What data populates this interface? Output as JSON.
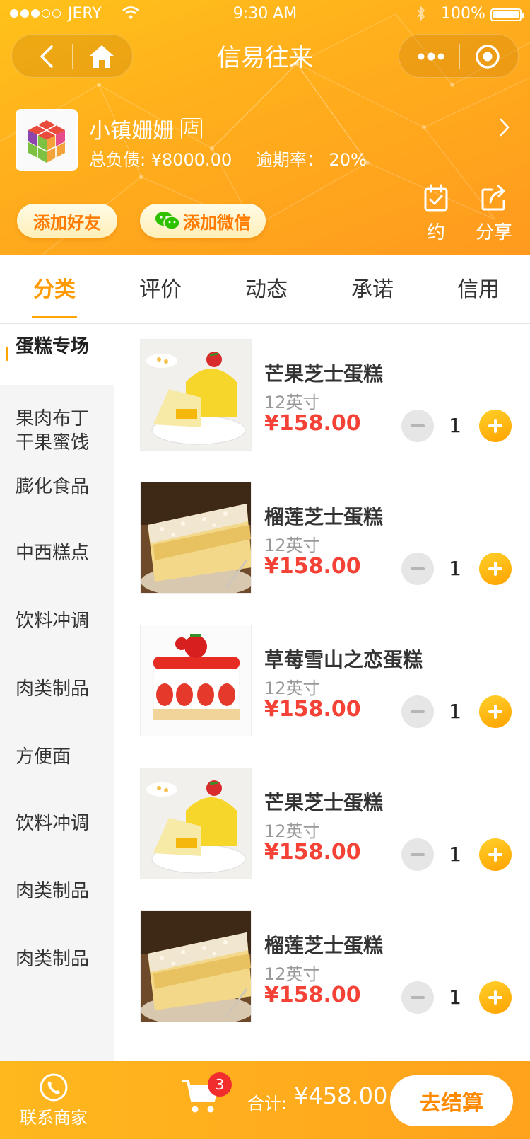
{
  "status_bar": {
    "carrier": "JERY",
    "time": "9:30 AM",
    "battery": "100%"
  },
  "nav": {
    "title": "信易往来"
  },
  "store": {
    "name": "小镇姗姗",
    "badge": "店",
    "debt": "总负债: ¥8000.00",
    "overdue": "逾期率： 20%"
  },
  "actions": {
    "add_friend": "添加好友",
    "add_wechat": "添加微信",
    "appointment": "约",
    "share": "分享"
  },
  "tabs": [
    {
      "label": "分类",
      "active": true
    },
    {
      "label": "评价",
      "active": false
    },
    {
      "label": "动态",
      "active": false
    },
    {
      "label": "承诺",
      "active": false
    },
    {
      "label": "信用",
      "active": false
    }
  ],
  "categories": [
    {
      "label": "蛋糕专场",
      "active": true
    },
    {
      "label": "果肉布丁\n干果蜜饯",
      "active": false
    },
    {
      "label": "膨化食品",
      "active": false
    },
    {
      "label": "中西糕点",
      "active": false
    },
    {
      "label": "饮料冲调",
      "active": false
    },
    {
      "label": "肉类制品",
      "active": false
    },
    {
      "label": "方便面",
      "active": false
    },
    {
      "label": "饮料冲调",
      "active": false
    },
    {
      "label": "肉类制品",
      "active": false
    },
    {
      "label": "肉类制品",
      "active": false
    }
  ],
  "products": [
    {
      "name": "芒果芝士蛋糕",
      "spec": "12英寸",
      "price": "¥158.00",
      "qty": "1",
      "image": "mango-cake"
    },
    {
      "name": "榴莲芝士蛋糕",
      "spec": "12英寸",
      "price": "¥158.00",
      "qty": "1",
      "image": "durian-cake"
    },
    {
      "name": "草莓雪山之恋蛋糕",
      "spec": "12英寸",
      "price": "¥158.00",
      "qty": "1",
      "image": "strawberry-cake"
    },
    {
      "name": "芒果芝士蛋糕",
      "spec": "12英寸",
      "price": "¥158.00",
      "qty": "1",
      "image": "mango-cake"
    },
    {
      "name": "榴莲芝士蛋糕",
      "spec": "12英寸",
      "price": "¥158.00",
      "qty": "1",
      "image": "durian-cake"
    }
  ],
  "bottom": {
    "contact": "联系商家",
    "cart_count": "3",
    "total_label": "合计:",
    "total_value": "¥458.00",
    "checkout": "去结算"
  },
  "colors": {
    "accent": "#ffa500",
    "header_start": "#ffc21a",
    "header_end": "#ff9a1e",
    "price": "#f44336",
    "cart_badge": "#f22d2d"
  }
}
